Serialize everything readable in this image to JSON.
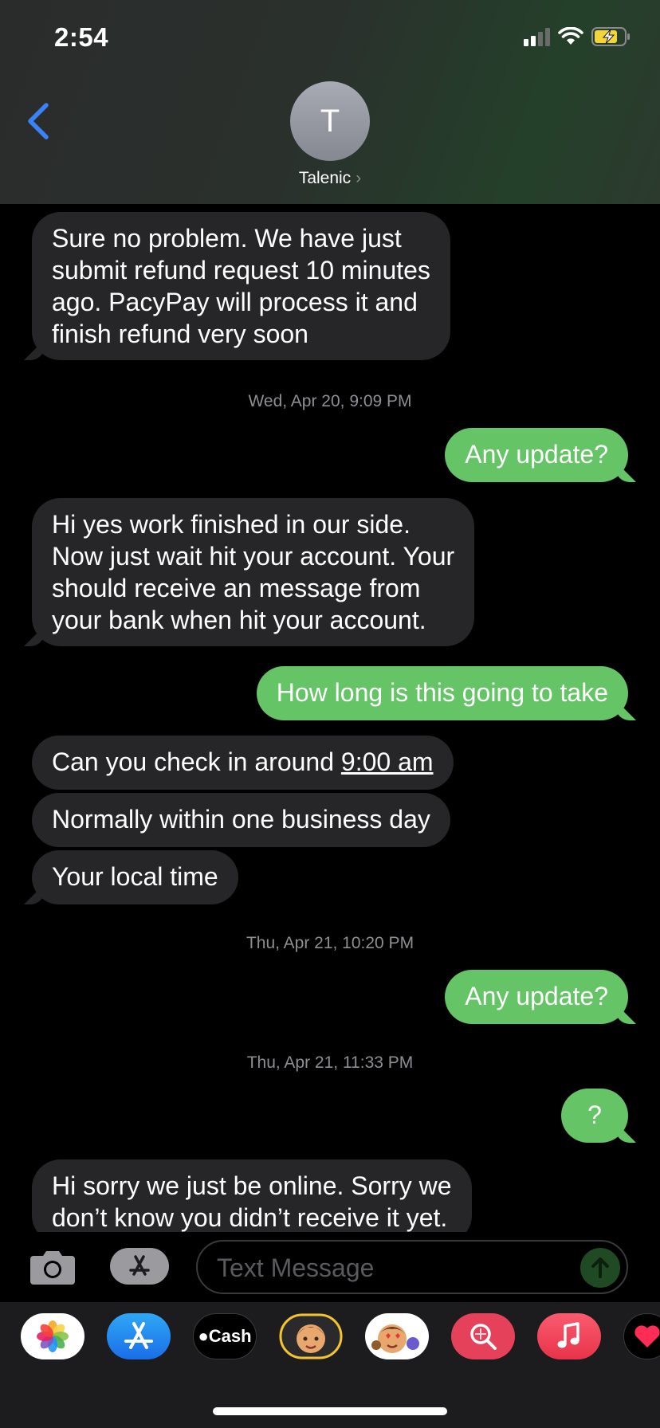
{
  "status_bar": {
    "time": "2:54"
  },
  "header": {
    "avatar_initial": "T",
    "contact_name": "Talenic",
    "back_icon": "chevron-left-icon"
  },
  "messages": [
    {
      "kind": "in",
      "text_lines": [
        "Sure no problem. We have just",
        "submit refund request 10 minutes",
        "ago. PacyPay will process it and",
        "finish refund very soon"
      ]
    },
    {
      "kind": "timestamp",
      "text": "Wed, Apr 20, 9:09 PM"
    },
    {
      "kind": "out",
      "text": "Any update?"
    },
    {
      "kind": "in",
      "text_lines": [
        "Hi yes work finished in our side.",
        "Now just wait hit your account. Your",
        "should receive an message from",
        "your bank when hit your account."
      ]
    },
    {
      "kind": "out",
      "text": "How long is this going to take"
    },
    {
      "kind": "in",
      "text_prefix": "Can you check in around ",
      "text_link": "9:00 am"
    },
    {
      "kind": "in",
      "text": "Normally within one business day"
    },
    {
      "kind": "in",
      "text": "Your local time"
    },
    {
      "kind": "timestamp",
      "text": "Thu, Apr 21, 10:20 PM"
    },
    {
      "kind": "out",
      "text": "Any update?"
    },
    {
      "kind": "timestamp",
      "text": "Thu, Apr 21, 11:33 PM"
    },
    {
      "kind": "out",
      "text": "?"
    },
    {
      "kind": "in",
      "text_lines": [
        "Hi sorry we just be online. Sorry we",
        "don’t know you didn’t receive it yet."
      ]
    }
  ],
  "input": {
    "placeholder": "Text Message"
  },
  "app_drawer": {
    "apps": [
      {
        "name": "photos-icon"
      },
      {
        "name": "app-store-icon"
      },
      {
        "name": "apple-cash-icon",
        "label": "Cash"
      },
      {
        "name": "memoji-icon"
      },
      {
        "name": "animoji-stickers-icon"
      },
      {
        "name": "image-search-icon"
      },
      {
        "name": "music-icon"
      },
      {
        "name": "digital-touch-icon"
      }
    ]
  },
  "colors": {
    "outgoing": "#65c466",
    "incoming": "#262628",
    "accent": "#3a82f7"
  }
}
